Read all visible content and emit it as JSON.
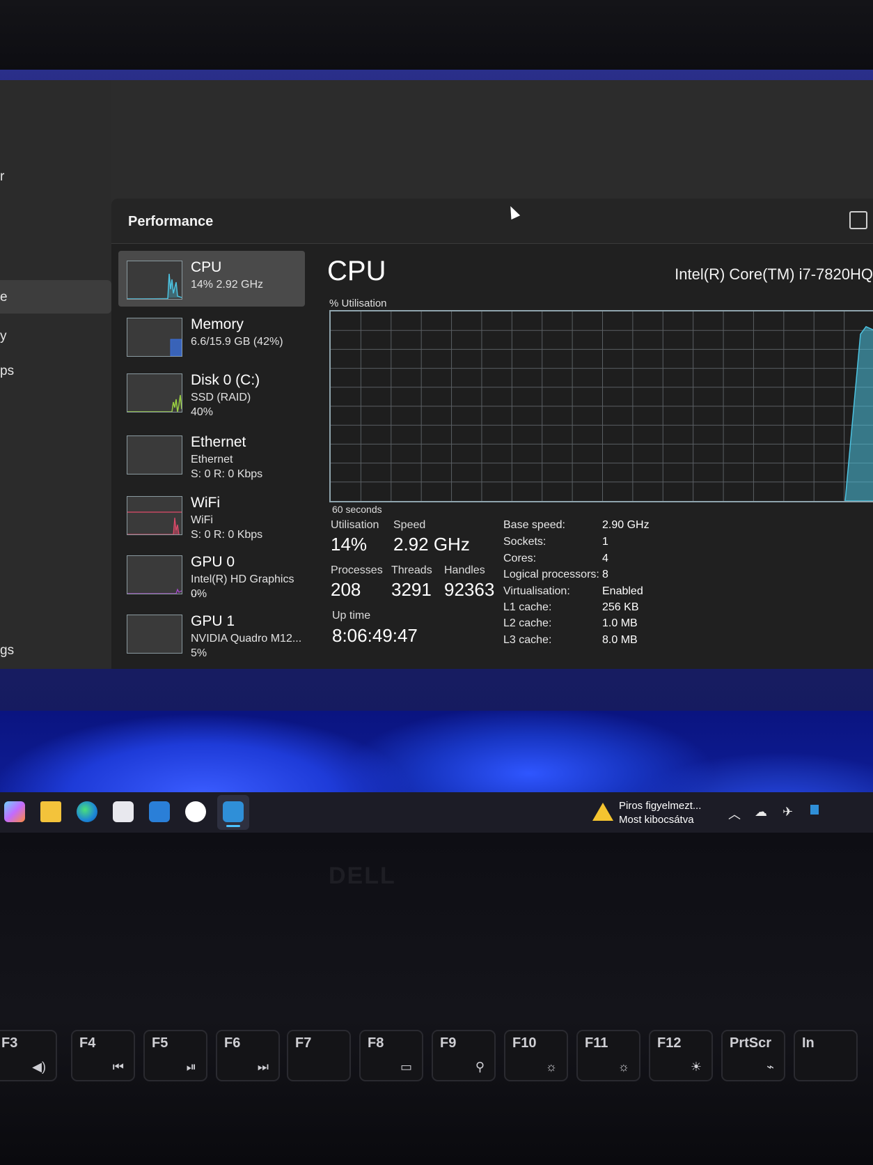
{
  "nav": {
    "items": [
      {
        "label": "r"
      },
      {
        "label": "e"
      },
      {
        "label": "y"
      },
      {
        "label": "ps"
      },
      {
        "label": "gs"
      }
    ]
  },
  "header": {
    "title": "Performance"
  },
  "devices": [
    {
      "name": "CPU",
      "line2": "14%  2.92 GHz",
      "line3": "",
      "selected": true,
      "color": "#4cc2e0"
    },
    {
      "name": "Memory",
      "line2": "6.6/15.9 GB (42%)",
      "line3": "",
      "color": "#3a6ed8"
    },
    {
      "name": "Disk 0 (C:)",
      "line2": "SSD (RAID)",
      "line3": "40%",
      "color": "#7fc43a"
    },
    {
      "name": "Ethernet",
      "line2": "Ethernet",
      "line3": "S: 0 R: 0 Kbps",
      "color": "#d77a2a"
    },
    {
      "name": "WiFi",
      "line2": "WiFi",
      "line3": "S: 0 R: 0 Kbps",
      "color": "#e04a6a"
    },
    {
      "name": "GPU 0",
      "line2": "Intel(R) HD Graphics ...",
      "line3": "0%",
      "color": "#b04ad8"
    },
    {
      "name": "GPU 1",
      "line2": "NVIDIA Quadro M12...",
      "line3": "5%",
      "color": "#b04ad8"
    }
  ],
  "detail": {
    "title": "CPU",
    "model": "Intel(R) Core(TM) i7-7820HQ",
    "graph_label": "% Utilisation",
    "graph_xlabel": "60 seconds",
    "graph_color": "#4cc2e0",
    "stats": {
      "utilisation_label": "Utilisation",
      "utilisation": "14%",
      "speed_label": "Speed",
      "speed": "2.92 GHz",
      "processes_label": "Processes",
      "processes": "208",
      "threads_label": "Threads",
      "threads": "3291",
      "handles_label": "Handles",
      "handles": "92363",
      "uptime_label": "Up time",
      "uptime": "8:06:49:47"
    },
    "specs": [
      {
        "key": "Base speed:",
        "value": "2.90 GHz"
      },
      {
        "key": "Sockets:",
        "value": "1"
      },
      {
        "key": "Cores:",
        "value": "4"
      },
      {
        "key": "Logical processors:",
        "value": "8"
      },
      {
        "key": "Virtualisation:",
        "value": "Enabled"
      },
      {
        "key": "L1 cache:",
        "value": "256 KB"
      },
      {
        "key": "L2 cache:",
        "value": "1.0 MB"
      },
      {
        "key": "L3 cache:",
        "value": "8.0 MB"
      }
    ]
  },
  "taskbar": {
    "apps": [
      {
        "icon": "copilot-icon"
      },
      {
        "icon": "file-explorer-icon"
      },
      {
        "icon": "edge-icon"
      },
      {
        "icon": "store-icon"
      },
      {
        "icon": "mail-icon"
      },
      {
        "icon": "slack-icon"
      },
      {
        "icon": "task-manager-icon",
        "active": true
      }
    ],
    "notification_title": "Piros figyelmezt...",
    "notification_sub": "Most kibocsátva"
  },
  "laptop": {
    "brand": "DELL",
    "keys": [
      {
        "label": "F3",
        "glyph": "◀)"
      },
      {
        "label": "F4",
        "glyph": "⏮"
      },
      {
        "label": "F5",
        "glyph": "⏯"
      },
      {
        "label": "F6",
        "glyph": "⏭"
      },
      {
        "label": "F7",
        "glyph": ""
      },
      {
        "label": "F8",
        "glyph": "▭"
      },
      {
        "label": "F9",
        "glyph": "⚲"
      },
      {
        "label": "F10",
        "glyph": "☼"
      },
      {
        "label": "F11",
        "glyph": "☼"
      },
      {
        "label": "F12",
        "glyph": "☀"
      },
      {
        "label": "PrtScr",
        "glyph": "⌁"
      },
      {
        "label": "In",
        "glyph": ""
      }
    ]
  }
}
